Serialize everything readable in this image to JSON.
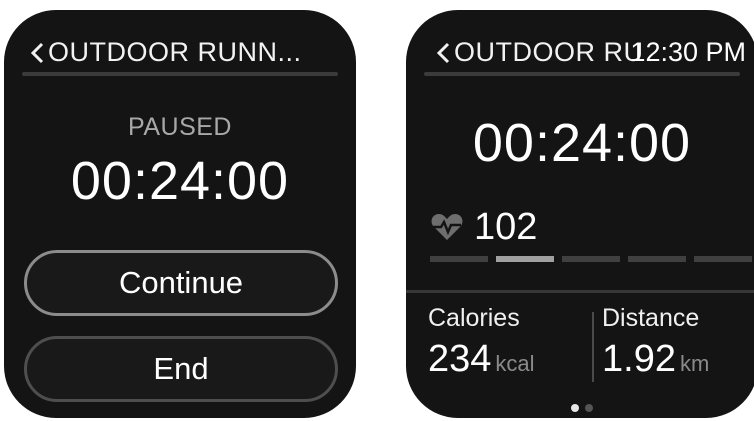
{
  "paused_screen": {
    "header_title": "OUTDOOR RUNN...",
    "status": "PAUSED",
    "timer": "00:24:00",
    "continue_label": "Continue",
    "end_label": "End"
  },
  "workout_screen": {
    "header_title": "OUTDOOR RU",
    "clock": "12:30 PM",
    "timer": "00:24:00",
    "heart_rate": "102",
    "heart_rate_zone": {
      "total_zones": 5,
      "active_zone": 2
    },
    "calories_label": "Calories",
    "calories_value": "234",
    "calories_unit": "kcal",
    "distance_label": "Distance",
    "distance_value": "1.92",
    "distance_unit": "km",
    "page_indicator": {
      "total_pages": 2,
      "current_page": 1
    }
  },
  "icons": {
    "back": "chevron-left-icon",
    "heart": "heart-rate-icon"
  },
  "colors": {
    "screen_background": "#141414",
    "text_primary": "#ffffff",
    "text_secondary": "#a8a8a8",
    "zone_active": "#a0a0a0",
    "zone_inactive": "#404040"
  }
}
